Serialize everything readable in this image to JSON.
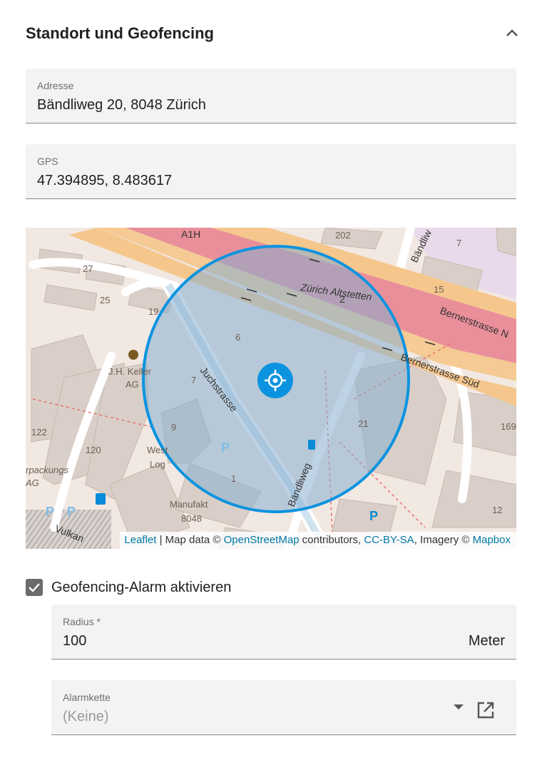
{
  "section": {
    "title": "Standort und Geofencing"
  },
  "address": {
    "label": "Adresse",
    "value": "Bändliweg 20, 8048 Zürich"
  },
  "gps": {
    "label": "GPS",
    "value": "47.394895, 8.483617"
  },
  "map": {
    "streets": [
      "A1H",
      "Zürich Altstetten",
      "2",
      "Bernerstrasse N",
      "Bernerstrasse Süd",
      "Juchstrasse",
      "Bändliweg",
      "Vulkan"
    ],
    "buildings": [
      "27",
      "25",
      "19",
      "6",
      "7",
      "9",
      "1",
      "21",
      "169",
      "12",
      "122",
      "120",
      "202",
      "7",
      "15",
      "J.H. Keller",
      "AG",
      "West",
      "Log",
      "Manufakt",
      "8048",
      "rpackungs",
      "AG"
    ],
    "markers": [
      "locate-marker",
      "parking",
      "bike-parking",
      "bus-stop",
      "fuel-station",
      "taxi"
    ],
    "attribution": {
      "leaflet": "Leaflet",
      "sep1": " | Map data © ",
      "osm": "OpenStreetMap",
      "sep2": " contributors, ",
      "license": "CC-BY-SA",
      "sep3": ", Imagery © ",
      "mapbox": "Mapbox"
    },
    "colors": {
      "geofence": "#0b93e0",
      "motorway": "#e8909a",
      "trunk": "#f6c98f"
    }
  },
  "geofence": {
    "checkbox_label": "Geofencing-Alarm aktivieren",
    "checked": true,
    "radius": {
      "label": "Radius *",
      "value": "100",
      "unit": "Meter"
    },
    "alarm_chain": {
      "label": "Alarmkette",
      "placeholder": "(Keine)"
    }
  }
}
